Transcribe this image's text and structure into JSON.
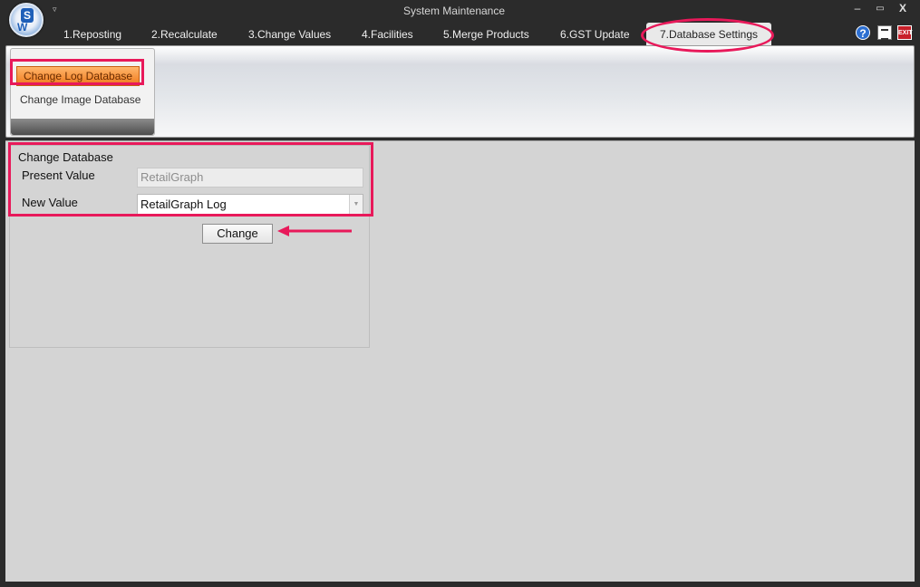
{
  "window": {
    "title": "System Maintenance",
    "logo_letters": [
      "S",
      "W"
    ],
    "qat_arrow": "▿",
    "controls": {
      "minimize": "–",
      "maximize": "▭",
      "close": "X"
    }
  },
  "tabs": [
    {
      "label": "1.Reposting"
    },
    {
      "label": "2.Recalculate"
    },
    {
      "label": "3.Change Values"
    },
    {
      "label": "4.Facilities"
    },
    {
      "label": "5.Merge Products"
    },
    {
      "label": "6.GST Update"
    },
    {
      "label": "7.Database Settings",
      "active": true
    }
  ],
  "toolbar_icons": {
    "help": "?",
    "exit": "EXIT"
  },
  "ribbon": {
    "buttons": [
      {
        "label": "Change Log Database",
        "selected": true
      },
      {
        "label": "Change Image Database",
        "selected": false
      }
    ]
  },
  "form": {
    "legend": "Change Database",
    "present_label": "Present Value",
    "present_value": "RetailGraph",
    "new_label": "New Value",
    "new_value": "RetailGraph Log",
    "dropdown_arrow": "▼",
    "change_label": "Change"
  },
  "colors": {
    "annotation": "#e8195a",
    "ribbon_selected": "#f07a1b",
    "titlebar": "#2b2b2b",
    "workspace": "#d4d4d4"
  }
}
